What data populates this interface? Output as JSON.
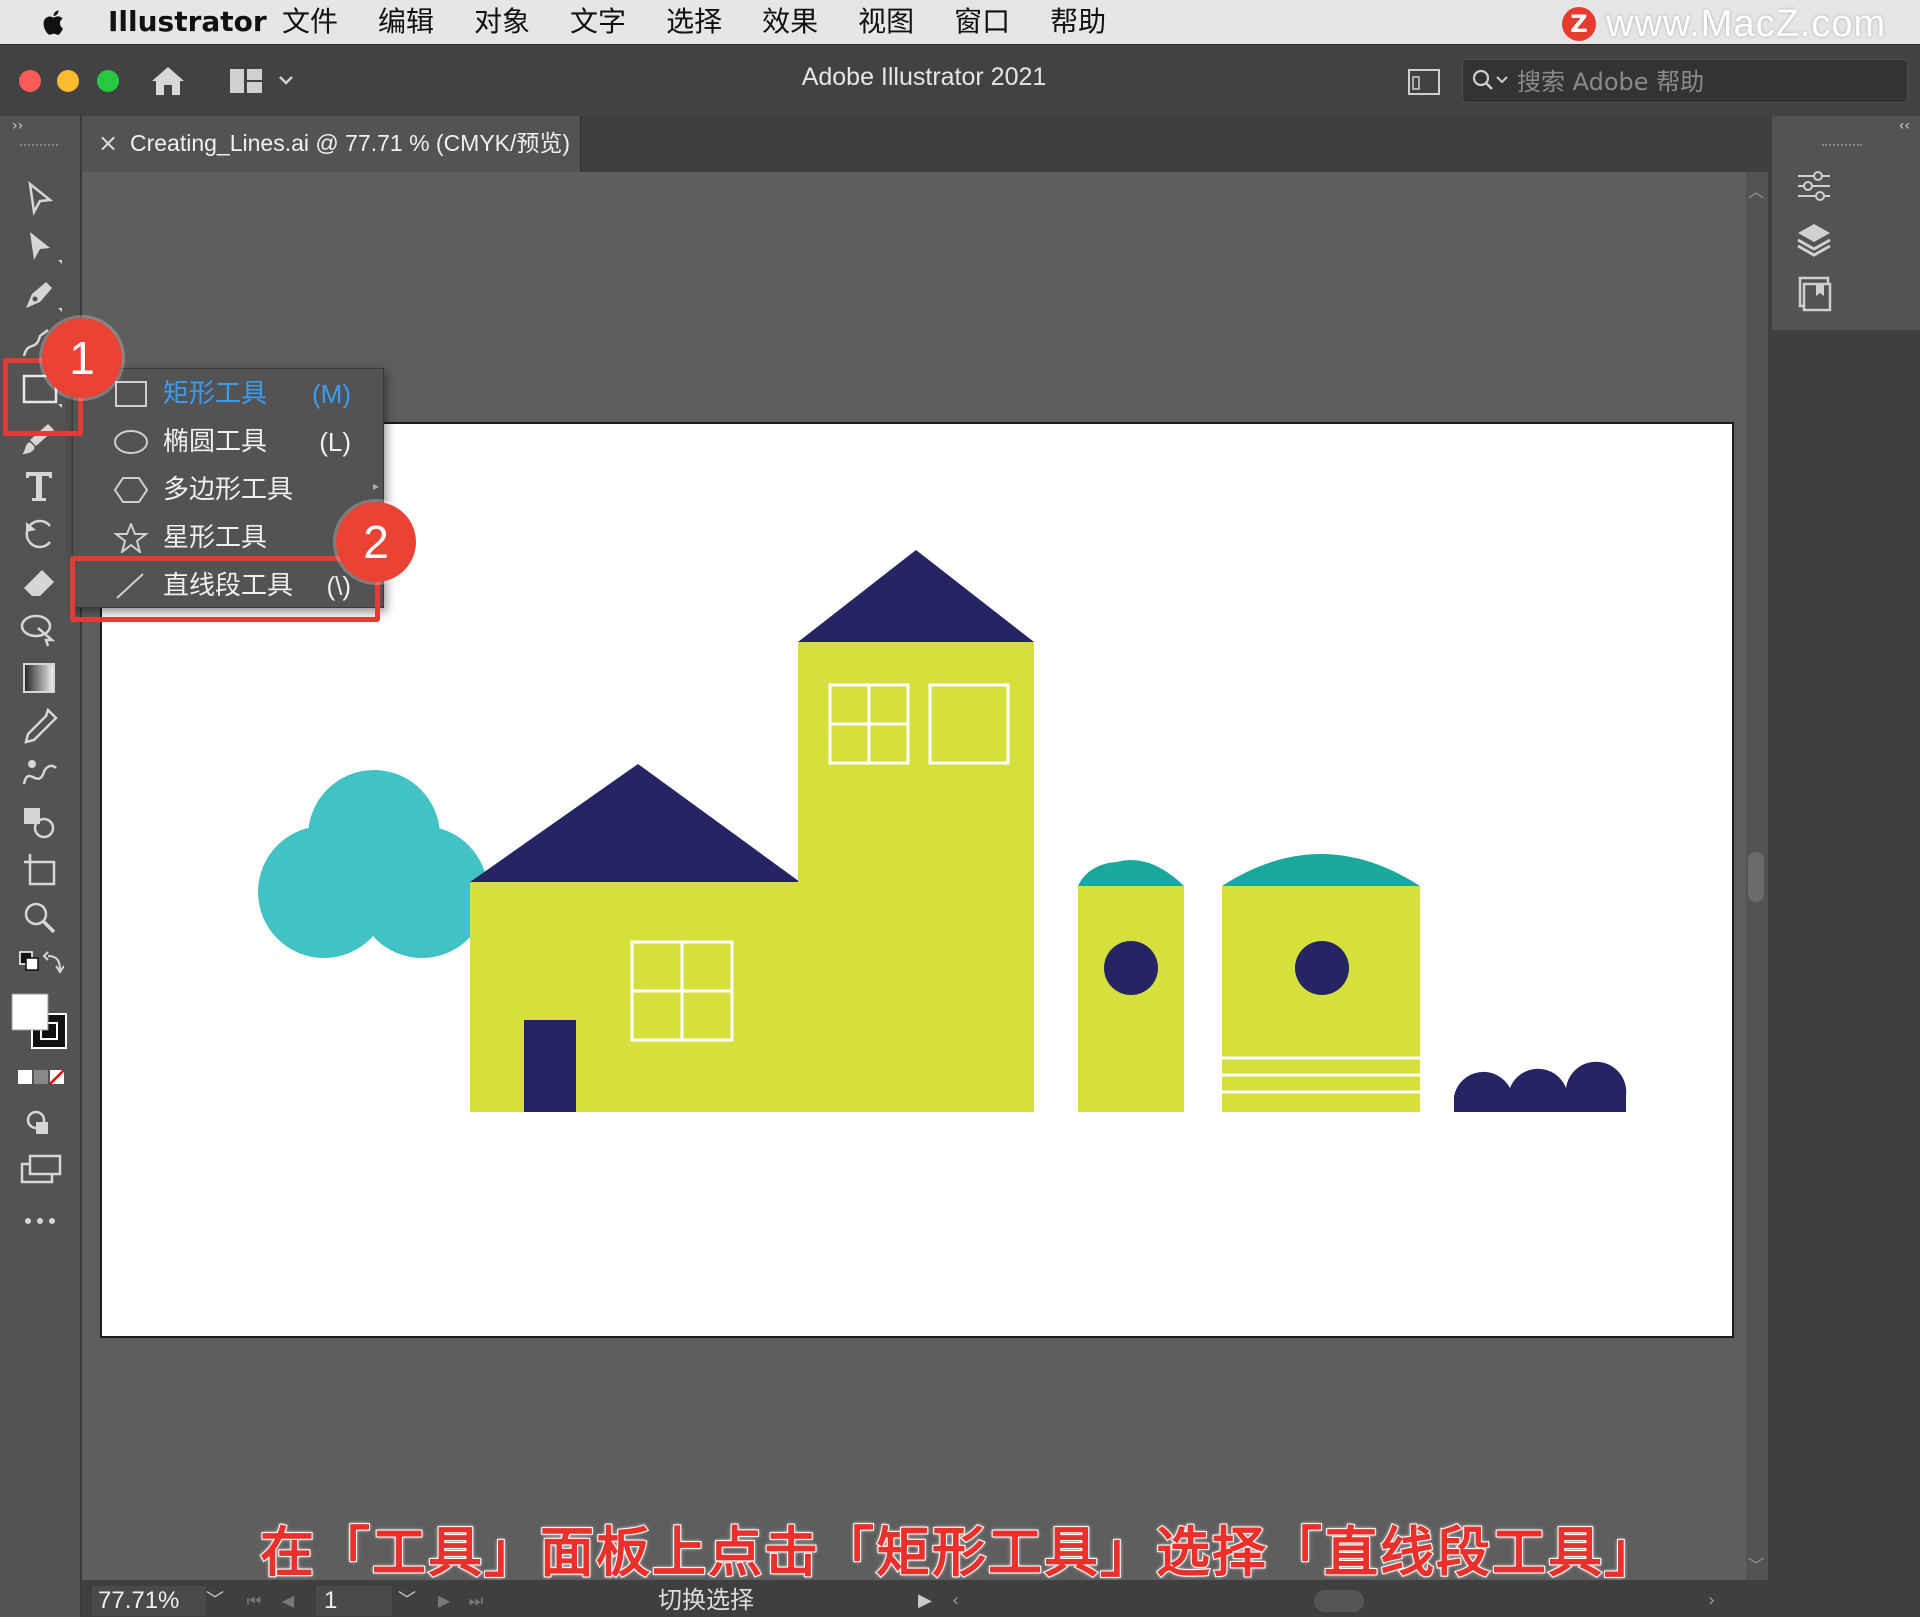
{
  "menubar": {
    "app_name": "Illustrator",
    "items": [
      "文件",
      "编辑",
      "对象",
      "文字",
      "选择",
      "效果",
      "视图",
      "窗口",
      "帮助"
    ]
  },
  "watermark": {
    "logo_letter": "Z",
    "text": "www.MacZ.com"
  },
  "titlebar": {
    "title": "Adobe Illustrator 2021",
    "search_placeholder": "搜索 Adobe 帮助"
  },
  "document_tab": {
    "close": "×",
    "label": "Creating_Lines.ai @ 77.71 % (CMYK/预览)"
  },
  "flyout": {
    "items": [
      {
        "label": "矩形工具",
        "shortcut": "(M)",
        "icon": "rectangle-icon",
        "selected": true
      },
      {
        "label": "椭圆工具",
        "shortcut": "(L)",
        "icon": "ellipse-icon",
        "selected": false
      },
      {
        "label": "多边形工具",
        "shortcut": "",
        "icon": "polygon-icon",
        "selected": false
      },
      {
        "label": "星形工具",
        "shortcut": "",
        "icon": "star-icon",
        "selected": false
      },
      {
        "label": "直线段工具",
        "shortcut": "(\\)",
        "icon": "line-segment-icon",
        "selected": false
      }
    ]
  },
  "annotations": {
    "badge1": "1",
    "badge2": "2",
    "caption": "在「工具」面板上点击「矩形工具」选择「直线段工具」"
  },
  "statusbar": {
    "zoom": "77.71%",
    "page": "1",
    "status_text": "切换选择"
  },
  "colors": {
    "house_yellow": "#d6e03c",
    "roof_navy": "#252564",
    "tree_teal": "#43c2c6",
    "dome_teal": "#1aa89c",
    "accent_red": "#e53a35",
    "selected_blue": "#3a9cf0"
  }
}
